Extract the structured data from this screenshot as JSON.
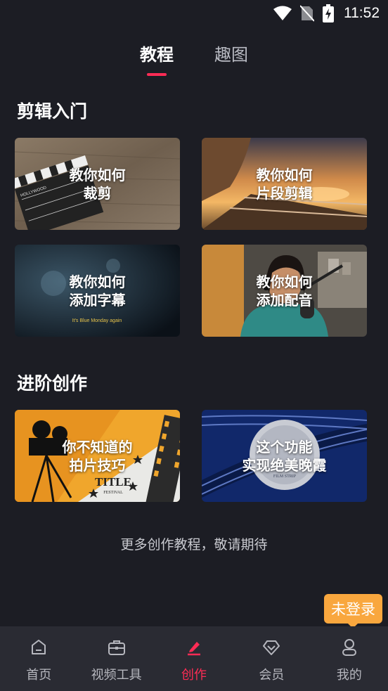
{
  "status_bar": {
    "time": "11:52"
  },
  "top_tabs": [
    {
      "label": "教程",
      "active": true
    },
    {
      "label": "趣图",
      "active": false
    }
  ],
  "sections": [
    {
      "title": "剪辑入门",
      "cards": [
        {
          "line1": "教你如何",
          "line2": "裁剪"
        },
        {
          "line1": "教你如何",
          "line2": "片段剪辑"
        },
        {
          "line1": "教你如何",
          "line2": "添加字幕"
        },
        {
          "line1": "教你如何",
          "line2": "添加配音"
        }
      ]
    },
    {
      "title": "进阶创作",
      "cards": [
        {
          "line1": "你不知道的",
          "line2": "拍片技巧"
        },
        {
          "line1": "这个功能",
          "line2": "实现绝美晚霞"
        }
      ]
    }
  ],
  "thumbnail_text": {
    "clapper": "HOLLYWOOD",
    "subtitle_sample": "It's Blue Monday again",
    "title_card": "TITLE",
    "festival": "FESTIVAL",
    "film_strip": "FILM STRIP"
  },
  "more_text": "更多创作教程，敬请期待",
  "login_tooltip": "未登录",
  "bottom_nav": [
    {
      "label": "首页",
      "icon": "home-icon",
      "active": false
    },
    {
      "label": "视频工具",
      "icon": "toolbox-icon",
      "active": false
    },
    {
      "label": "创作",
      "icon": "pen-icon",
      "active": true
    },
    {
      "label": "会员",
      "icon": "diamond-icon",
      "active": false
    },
    {
      "label": "我的",
      "icon": "user-icon",
      "active": false
    }
  ],
  "colors": {
    "background": "#1c1d24",
    "accent": "#fe2c55",
    "tooltip": "#f9a73e",
    "nav_bg": "#2a2b33"
  }
}
